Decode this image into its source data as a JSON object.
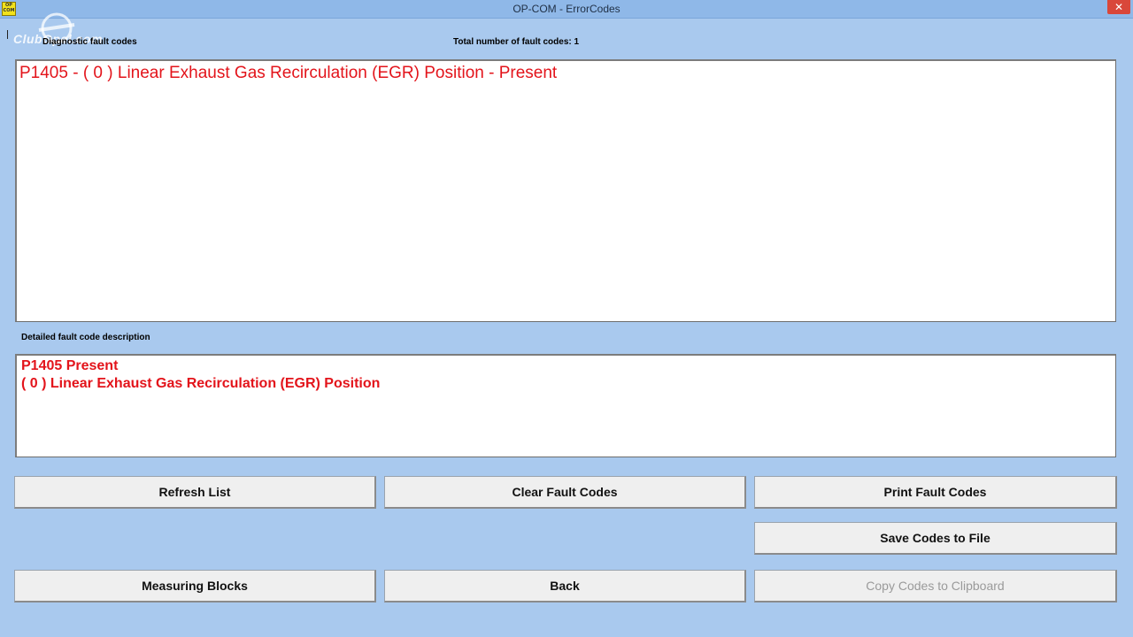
{
  "window": {
    "title": "OP-COM - ErrorCodes",
    "app_icon_text": "OP COM",
    "close_glyph": "✕"
  },
  "watermark": "ClubOpel.com",
  "labels": {
    "fault_codes": "Diagnostic fault codes",
    "total": "Total number of fault codes:  1",
    "detailed": "Detailed fault code description"
  },
  "fault_list": [
    "P1405 - ( 0 )  Linear Exhaust Gas Recirculation (EGR) Position - Present"
  ],
  "description": {
    "line1": "P1405  Present",
    "line2": "( 0 )  Linear Exhaust Gas Recirculation (EGR) Position"
  },
  "buttons": {
    "refresh": "Refresh List",
    "clear": "Clear Fault Codes",
    "print": "Print Fault Codes",
    "save": "Save Codes to File",
    "measuring": "Measuring Blocks",
    "back": "Back",
    "copy": "Copy Codes to Clipboard"
  }
}
